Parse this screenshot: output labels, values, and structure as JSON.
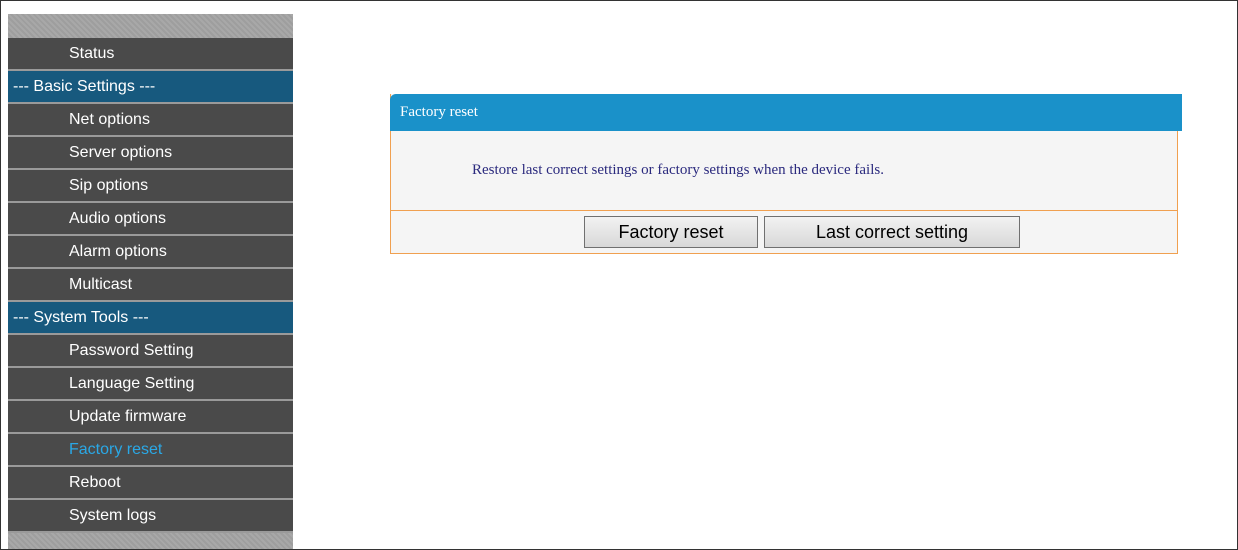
{
  "sidebar": {
    "items": [
      {
        "label": "Status",
        "type": "item",
        "active": false
      },
      {
        "label": "--- Basic Settings ---",
        "type": "header",
        "active": false
      },
      {
        "label": "Net options",
        "type": "item",
        "active": false
      },
      {
        "label": "Server options",
        "type": "item",
        "active": false
      },
      {
        "label": "Sip options",
        "type": "item",
        "active": false
      },
      {
        "label": "Audio options",
        "type": "item",
        "active": false
      },
      {
        "label": "Alarm options",
        "type": "item",
        "active": false
      },
      {
        "label": "Multicast",
        "type": "item",
        "active": false
      },
      {
        "label": "--- System Tools ---",
        "type": "header",
        "active": false
      },
      {
        "label": "Password Setting",
        "type": "item",
        "active": false
      },
      {
        "label": "Language Setting",
        "type": "item",
        "active": false
      },
      {
        "label": "Update firmware",
        "type": "item",
        "active": false
      },
      {
        "label": "Factory reset",
        "type": "item",
        "active": true
      },
      {
        "label": "Reboot",
        "type": "item",
        "active": false
      },
      {
        "label": "System logs",
        "type": "item",
        "active": false
      }
    ]
  },
  "panel": {
    "title": "Factory reset",
    "message": "Restore last correct settings or factory settings when the device fails.",
    "factory_reset_label": "Factory reset",
    "last_correct_label": "Last correct setting"
  },
  "colors": {
    "header_blue": "#17597e",
    "panel_title_blue": "#1a91c9",
    "active_item_text": "#2aa8e6",
    "panel_border": "#f0a050",
    "message_text": "#2b2a7e"
  }
}
